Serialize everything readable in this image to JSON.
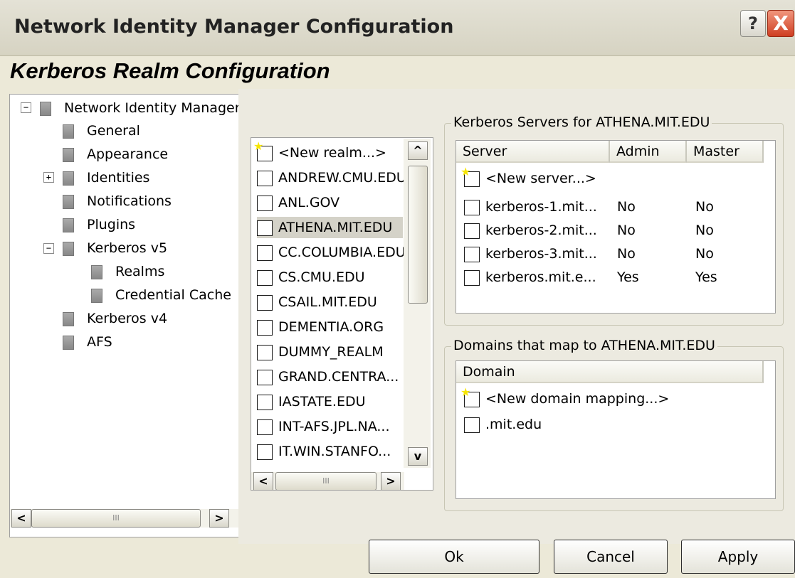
{
  "window": {
    "title": "Network Identity Manager Configuration",
    "help_label": "?",
    "close_label": "X"
  },
  "page_heading": "Kerberos Realm Configuration",
  "tree": {
    "root": "Network Identity Manager",
    "items": [
      {
        "label": "General"
      },
      {
        "label": "Appearance"
      },
      {
        "label": "Identities"
      },
      {
        "label": "Notifications"
      },
      {
        "label": "Plugins"
      },
      {
        "label": "Kerberos v5"
      },
      {
        "label": "Realms"
      },
      {
        "label": "Credential Cache"
      },
      {
        "label": "Kerberos v4"
      },
      {
        "label": "AFS"
      }
    ],
    "expand_minus": "−",
    "expand_plus": "+"
  },
  "realms": {
    "selected": "ATHENA.MIT.EDU",
    "items": [
      "<New realm...>",
      "ANDREW.CMU.EDU",
      "ANL.GOV",
      "ATHENA.MIT.EDU",
      "CC.COLUMBIA.EDU",
      "CS.CMU.EDU",
      "CSAIL.MIT.EDU",
      "DEMENTIA.ORG",
      "DUMMY_REALM",
      "GRAND.CENTRA...",
      "IASTATE.EDU",
      "INT-AFS.JPL.NA...",
      "IT.WIN.STANFO..."
    ]
  },
  "servers": {
    "group_label": "Kerberos Servers for ATHENA.MIT.EDU",
    "columns": [
      "Server",
      "Admin",
      "Master"
    ],
    "new_label": "<New server...>",
    "rows": [
      {
        "server": "kerberos-1.mit...",
        "admin": "No",
        "master": "No"
      },
      {
        "server": "kerberos-2.mit...",
        "admin": "No",
        "master": "No"
      },
      {
        "server": "kerberos-3.mit...",
        "admin": "No",
        "master": "No"
      },
      {
        "server": "kerberos.mit.e...",
        "admin": "Yes",
        "master": "Yes"
      }
    ]
  },
  "domains": {
    "group_label": "Domains that map to ATHENA.MIT.EDU",
    "column": "Domain",
    "new_label": "<New domain mapping...>",
    "rows": [
      ".mit.edu"
    ]
  },
  "scroll": {
    "left_arrow": "<",
    "right_arrow": ">",
    "up_arrow": "^",
    "down_arrow": "v",
    "grip": "III"
  },
  "buttons": {
    "ok": "Ok",
    "cancel": "Cancel",
    "apply": "Apply"
  }
}
